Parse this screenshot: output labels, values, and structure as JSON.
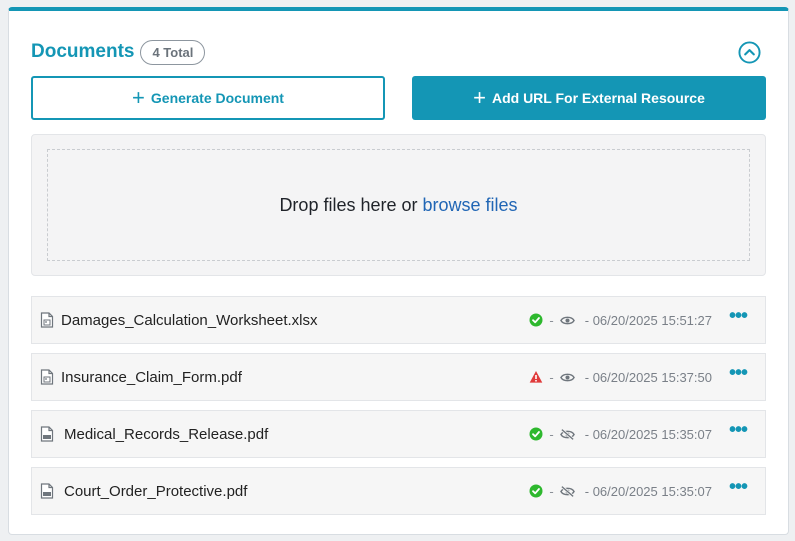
{
  "header": {
    "title": "Documents",
    "badge": "4 Total"
  },
  "buttons": {
    "generate": "Generate Document",
    "add_url": "Add URL For External Resource"
  },
  "dropzone": {
    "text": "Drop files here or",
    "link": "browse files"
  },
  "files": [
    {
      "name": "Damages_Calculation_Worksheet.xlsx",
      "file_icon": "spreadsheet-file-icon",
      "status": "success",
      "visibility": "visible",
      "separator": "-",
      "timestamp": "- 06/20/2025 15:51:27"
    },
    {
      "name": "Insurance_Claim_Form.pdf",
      "file_icon": "image-file-icon",
      "status": "warning",
      "visibility": "visible",
      "separator": "-",
      "timestamp": "- 06/20/2025 15:37:50"
    },
    {
      "name": "Medical_Records_Release.pdf",
      "file_icon": "pdf-file-icon",
      "status": "success",
      "visibility": "hidden",
      "separator": "-",
      "timestamp": "- 06/20/2025 15:35:07"
    },
    {
      "name": "Court_Order_Protective.pdf",
      "file_icon": "pdf-file-icon",
      "status": "success",
      "visibility": "hidden",
      "separator": "-",
      "timestamp": "- 06/20/2025 15:35:07"
    }
  ],
  "colors": {
    "accent": "#1496b5",
    "success": "#2eb82e",
    "warning": "#e03b3b",
    "link": "#2166b5"
  }
}
